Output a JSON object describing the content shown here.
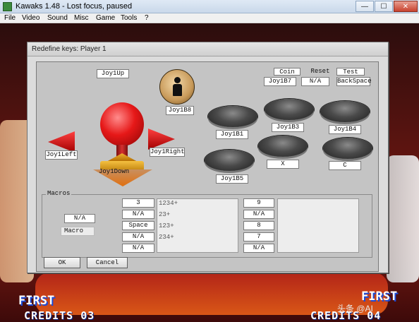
{
  "window": {
    "title": "Kawaks 1.48 - Lost focus, paused",
    "minimize_glyph": "—",
    "maximize_glyph": "☐",
    "close_glyph": "✕"
  },
  "menu": [
    "File",
    "Video",
    "Sound",
    "Misc",
    "Game",
    "Tools",
    "?"
  ],
  "dialog": {
    "title": "Redefine keys: Player 1",
    "joystick": {
      "up": "Joy1Up",
      "down": "Joy1Down",
      "left": "Joy1Left",
      "right": "Joy1Right"
    },
    "start_button": "Joy1B8",
    "coin": {
      "label": "Coin",
      "value": "Joy1B7"
    },
    "reset": {
      "label": "Reset",
      "value": "N/A"
    },
    "test": {
      "label": "Test",
      "value": "BackSpace"
    },
    "buttons": {
      "a": "Joy1B1",
      "b": "Joy1B3",
      "c": "Joy1B4",
      "d": "Joy1B5",
      "x": "X",
      "z": "C"
    },
    "macros": {
      "title": "Macros",
      "macro_value": "N/A",
      "macro_label": "Macro",
      "left_keys": [
        "3",
        "N/A",
        "Space",
        "N/A",
        "N/A"
      ],
      "left_sequences": [
        "1234+",
        "23+",
        "123+",
        "234+"
      ],
      "right_keys": [
        "9",
        "N/A",
        "8",
        "7",
        "N/A"
      ]
    },
    "ok": "OK",
    "cancel": "Cancel"
  },
  "game_overlay": {
    "first_left": "FIRST",
    "first_right": "FIRST",
    "credits_left": "CREDITS 03",
    "credits_right": "CREDITS 04",
    "watermark": "头条 @AI"
  }
}
